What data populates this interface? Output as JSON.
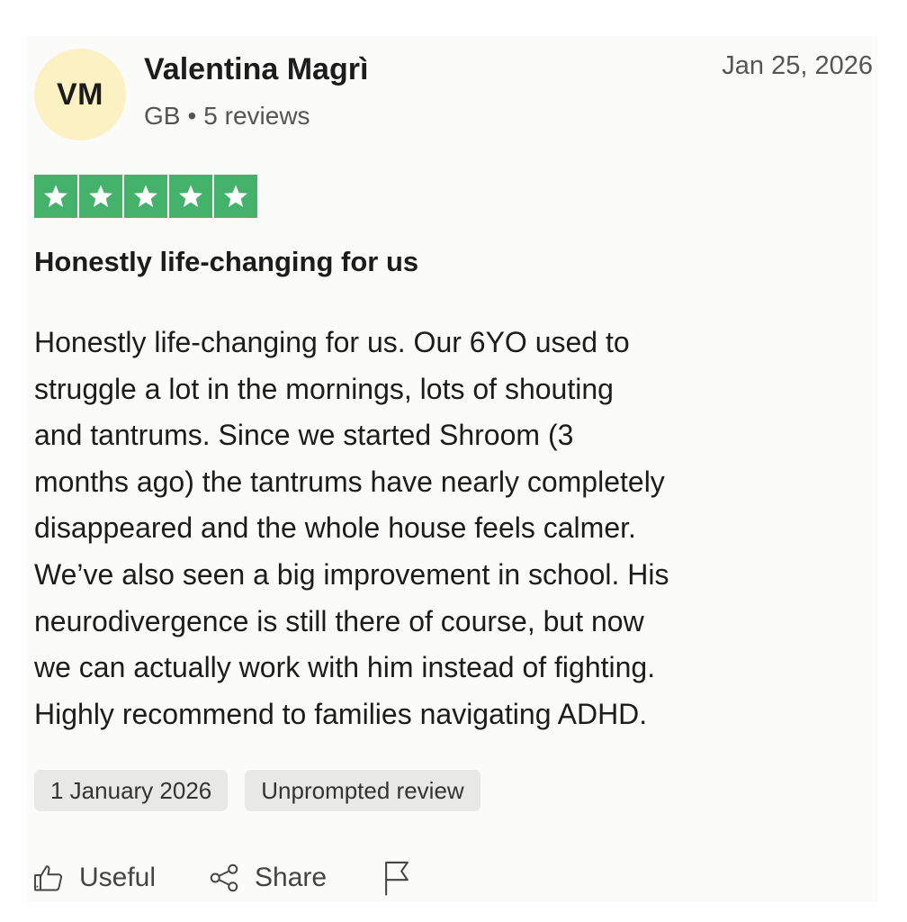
{
  "reviewer": {
    "initials": "VM",
    "name": "Valentina Magrì",
    "country": "GB",
    "separator": "•",
    "reviews_count": "5 reviews",
    "avatar_color": "#fcf1c2"
  },
  "review": {
    "date": "Jan 25, 2026",
    "rating": 5,
    "max_rating": 5,
    "star_color": "#45b26c",
    "title": "Honestly life-changing for us",
    "body": "Honestly life-changing for us. Our 6YO used to\nstruggle a lot in the mornings, lots of shouting\nand tantrums. Since we started Shroom (3\nmonths ago) the tantrums have nearly completely\ndisappeared and the whole house feels calmer.\nWe’ve also seen a big improvement in school. His\nneurodivergence is still there of course, but now\nwe can actually work with him instead of fighting.\nHighly recommend to families navigating ADHD."
  },
  "tags": {
    "experience_date": "1 January 2026",
    "type": "Unprompted review"
  },
  "actions": {
    "useful_label": "Useful",
    "useful_icon": "thumbs-up-icon",
    "share_label": "Share",
    "share_icon": "share-icon",
    "report_icon": "flag-icon"
  }
}
